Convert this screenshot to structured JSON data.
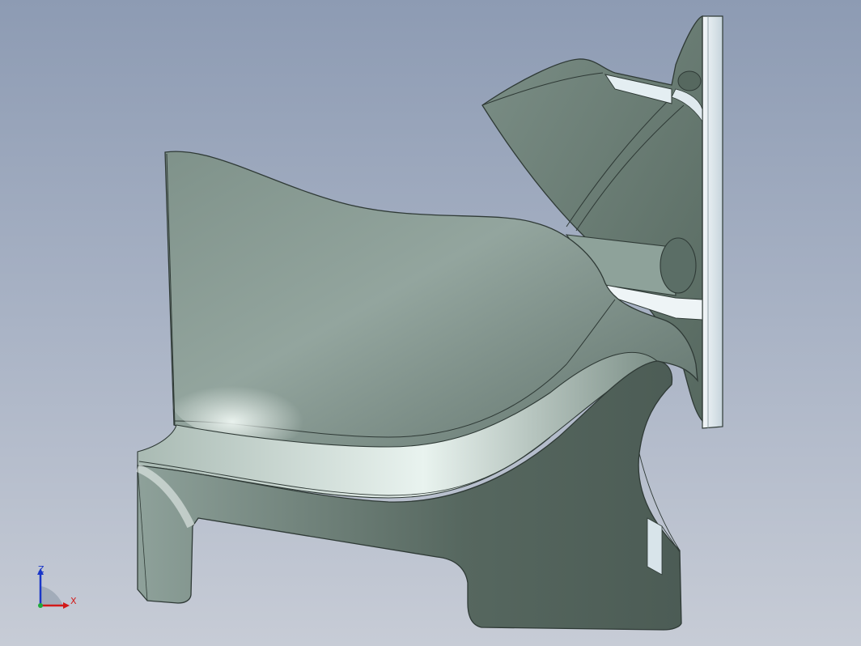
{
  "viewport": {
    "background_top": "#8d9bb3",
    "background_bottom": "#c7ccd6",
    "model_color": "#7f928a"
  },
  "triad": {
    "z_label": "Z",
    "x_label": "X",
    "z_color": "#1a36c8",
    "x_color": "#d21a1a"
  }
}
